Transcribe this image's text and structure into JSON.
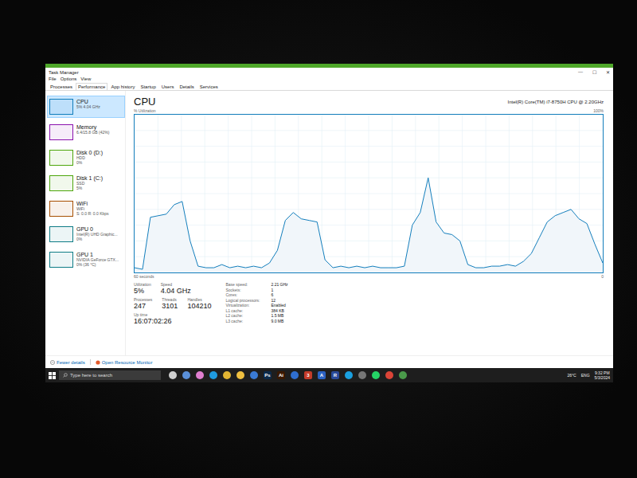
{
  "window": {
    "title": "Task Manager",
    "controls": [
      "—",
      "☐",
      "✕"
    ]
  },
  "menu": [
    "File",
    "Options",
    "View"
  ],
  "tabs": [
    {
      "label": "Processes",
      "selected": false
    },
    {
      "label": "Performance",
      "selected": true
    },
    {
      "label": "App history",
      "selected": false
    },
    {
      "label": "Startup",
      "selected": false
    },
    {
      "label": "Users",
      "selected": false
    },
    {
      "label": "Details",
      "selected": false
    },
    {
      "label": "Services",
      "selected": false
    }
  ],
  "sidebar": {
    "items": [
      {
        "name": "CPU",
        "lines": [
          "5% 4.04 GHz"
        ],
        "selected": true,
        "color": "#117dbb"
      },
      {
        "name": "Memory",
        "lines": [
          "6.4/15.8 GB (42%)"
        ],
        "selected": false,
        "color": "#8b12ae"
      },
      {
        "name": "Disk 0 (D:)",
        "lines": [
          "HDD",
          "0%"
        ],
        "selected": false,
        "color": "#4da60c"
      },
      {
        "name": "Disk 1 (C:)",
        "lines": [
          "SSD",
          "5%"
        ],
        "selected": false,
        "color": "#4da60c"
      },
      {
        "name": "WiFi",
        "lines": [
          "WiFi",
          "S: 0.0 R: 0.0 Kbps"
        ],
        "selected": false,
        "color": "#a74f01"
      },
      {
        "name": "GPU 0",
        "lines": [
          "Intel(R) UHD Graphic...",
          "0%"
        ],
        "selected": false,
        "color": "#0e7c86"
      },
      {
        "name": "GPU 1",
        "lines": [
          "NVIDIA GeForce GTX...",
          "0% (36 °C)"
        ],
        "selected": false,
        "color": "#0e7c86"
      }
    ]
  },
  "cpu": {
    "title": "CPU",
    "model": "Intel(R) Core(TM) i7-8750H CPU @ 2.20GHz",
    "axis": {
      "label": "% Utilization",
      "max": "100%",
      "span": "60 seconds",
      "min": "0"
    },
    "series": [
      3,
      2,
      35,
      36,
      37,
      43,
      45,
      20,
      4,
      3,
      3,
      5,
      3,
      4,
      3,
      4,
      3,
      6,
      14,
      33,
      38,
      34,
      33,
      32,
      8,
      3,
      4,
      3,
      4,
      3,
      4,
      3,
      3,
      3,
      4,
      30,
      38,
      60,
      32,
      25,
      24,
      20,
      5,
      3,
      3,
      4,
      4,
      5,
      4,
      7,
      12,
      22,
      32,
      36,
      38,
      40,
      34,
      31,
      18,
      6
    ]
  },
  "stats": [
    [
      {
        "label": "Utilization",
        "value": "5%"
      },
      {
        "label": "Speed",
        "value": "4.04 GHz"
      }
    ],
    [
      {
        "label": "Processes",
        "value": "247"
      },
      {
        "label": "Threads",
        "value": "3101"
      },
      {
        "label": "Handles",
        "value": "104210"
      }
    ],
    [
      {
        "label": "Up time",
        "value": "16:07:02:26"
      }
    ]
  ],
  "specs": [
    {
      "label": "Base speed:",
      "value": "2.21 GHz"
    },
    {
      "label": "Sockets:",
      "value": "1"
    },
    {
      "label": "Cores:",
      "value": "6"
    },
    {
      "label": "Logical processors:",
      "value": "12"
    },
    {
      "label": "Virtualization:",
      "value": "Enabled"
    },
    {
      "label": "L1 cache:",
      "value": "384 KB"
    },
    {
      "label": "L2 cache:",
      "value": "1.5 MB"
    },
    {
      "label": "L3 cache:",
      "value": "9.0 MB"
    }
  ],
  "footer": {
    "fewer": "Fewer details",
    "monitor": "Open Resource Monitor"
  },
  "taskbar": {
    "search": "Type here to search",
    "apps": [
      {
        "label": "",
        "color": "#d0d0d0"
      },
      {
        "label": "",
        "color": "#5a8fd8"
      },
      {
        "label": "",
        "color": "#e07fd0"
      },
      {
        "label": "",
        "color": "#1f9be0"
      },
      {
        "label": "",
        "color": "#e2b533"
      },
      {
        "label": "",
        "color": "#f0c040"
      },
      {
        "label": "",
        "color": "#3a7bd5"
      },
      {
        "label": "Ps",
        "color": "#0b2a4a"
      },
      {
        "label": "Ai",
        "color": "#3a1800"
      },
      {
        "label": "",
        "color": "#2f6fd0"
      },
      {
        "label": "3",
        "color": "#c43c2a"
      },
      {
        "label": "A",
        "color": "#2b63c4"
      },
      {
        "label": "R",
        "color": "#2a4a9a"
      },
      {
        "label": "",
        "color": "#1aa0e0"
      },
      {
        "label": "",
        "color": "#777777"
      },
      {
        "label": "",
        "color": "#25d366"
      },
      {
        "label": "",
        "color": "#db4437"
      },
      {
        "label": "",
        "color": "#4a9a4a"
      }
    ],
    "weather": "26°C",
    "language": "ENG",
    "time": "9:32 PM",
    "date": "5/3/2024"
  }
}
